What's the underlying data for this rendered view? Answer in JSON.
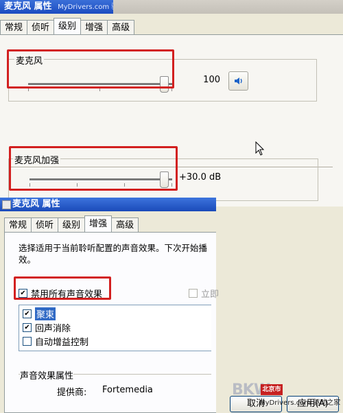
{
  "back_window": {
    "title": "麦克风 属性",
    "watermark": "MyDrivers.com 驱动之家",
    "tabs": [
      "常规",
      "侦听",
      "级别",
      "增强",
      "高级"
    ],
    "active_tab": 2,
    "mic_group": {
      "label": "麦克风",
      "value": "100",
      "level": 1.0
    },
    "boost_group": {
      "label": "麦克风加强",
      "value": "+30.0 dB",
      "level": 1.0
    }
  },
  "front_window": {
    "title": "麦克风 属性",
    "tabs": [
      "常规",
      "侦听",
      "级别",
      "增强",
      "高级"
    ],
    "active_tab": 3,
    "description": [
      "选择适用于当前聆听配置的声音效果。下次开始播",
      "效。"
    ],
    "disable_all": {
      "label": "禁用所有声音效果",
      "checked": true
    },
    "immediate": {
      "label": "立即",
      "checked": false
    },
    "effects": [
      {
        "label": "聚束",
        "checked": true,
        "selected": true
      },
      {
        "label": "回声消除",
        "checked": true,
        "selected": false
      },
      {
        "label": "自动增益控制",
        "checked": false,
        "selected": false
      }
    ],
    "properties_label": "声音效果属性",
    "provider_label": "提供商:",
    "provider_value": "Fortemedia",
    "buttons": {
      "cancel": "取消",
      "apply": "应用(A)"
    }
  },
  "site_logo": {
    "text": "BKW",
    "badge": "北京市场"
  },
  "bottom_watermark": "MyDrivers.com 驱动之家",
  "colors": {
    "highlight_box": "#d21f1f",
    "title_bar": "#1c4cc0",
    "selection": "#316ac5"
  }
}
